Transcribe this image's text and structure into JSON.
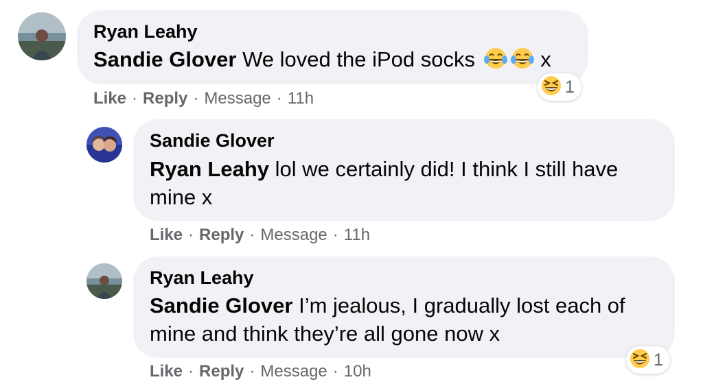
{
  "comments": [
    {
      "author": "Ryan Leahy",
      "mention": "Sandie Glover",
      "text_line1": " We loved the iPod socks ",
      "text_line2": "",
      "emojis": [
        "tears-of-joy",
        "tears-of-joy"
      ],
      "trailing": " x",
      "reaction": {
        "emoji": "laughing",
        "count": "1"
      },
      "actions": {
        "like": "Like",
        "reply": "Reply",
        "message": "Message",
        "time": "11h"
      }
    },
    {
      "author": "Sandie Glover",
      "mention": "Ryan Leahy",
      "text_line1": " lol we certainly did! I think I still have",
      "text_line2": "mine x",
      "actions": {
        "like": "Like",
        "reply": "Reply",
        "message": "Message",
        "time": "11h"
      }
    },
    {
      "author": "Ryan Leahy",
      "mention": "Sandie Glover",
      "text_line1": " I’m jealous, I gradually lost each of",
      "text_line2": "mine and think they’re all gone now x",
      "reaction": {
        "emoji": "laughing",
        "count": "1"
      },
      "actions": {
        "like": "Like",
        "reply": "Reply",
        "message": "Message",
        "time": "10h"
      }
    }
  ],
  "colors": {
    "bubble": "#f0f2f5",
    "meta": "#65676b",
    "text": "#050505",
    "emoji": "#ffcc4d"
  }
}
